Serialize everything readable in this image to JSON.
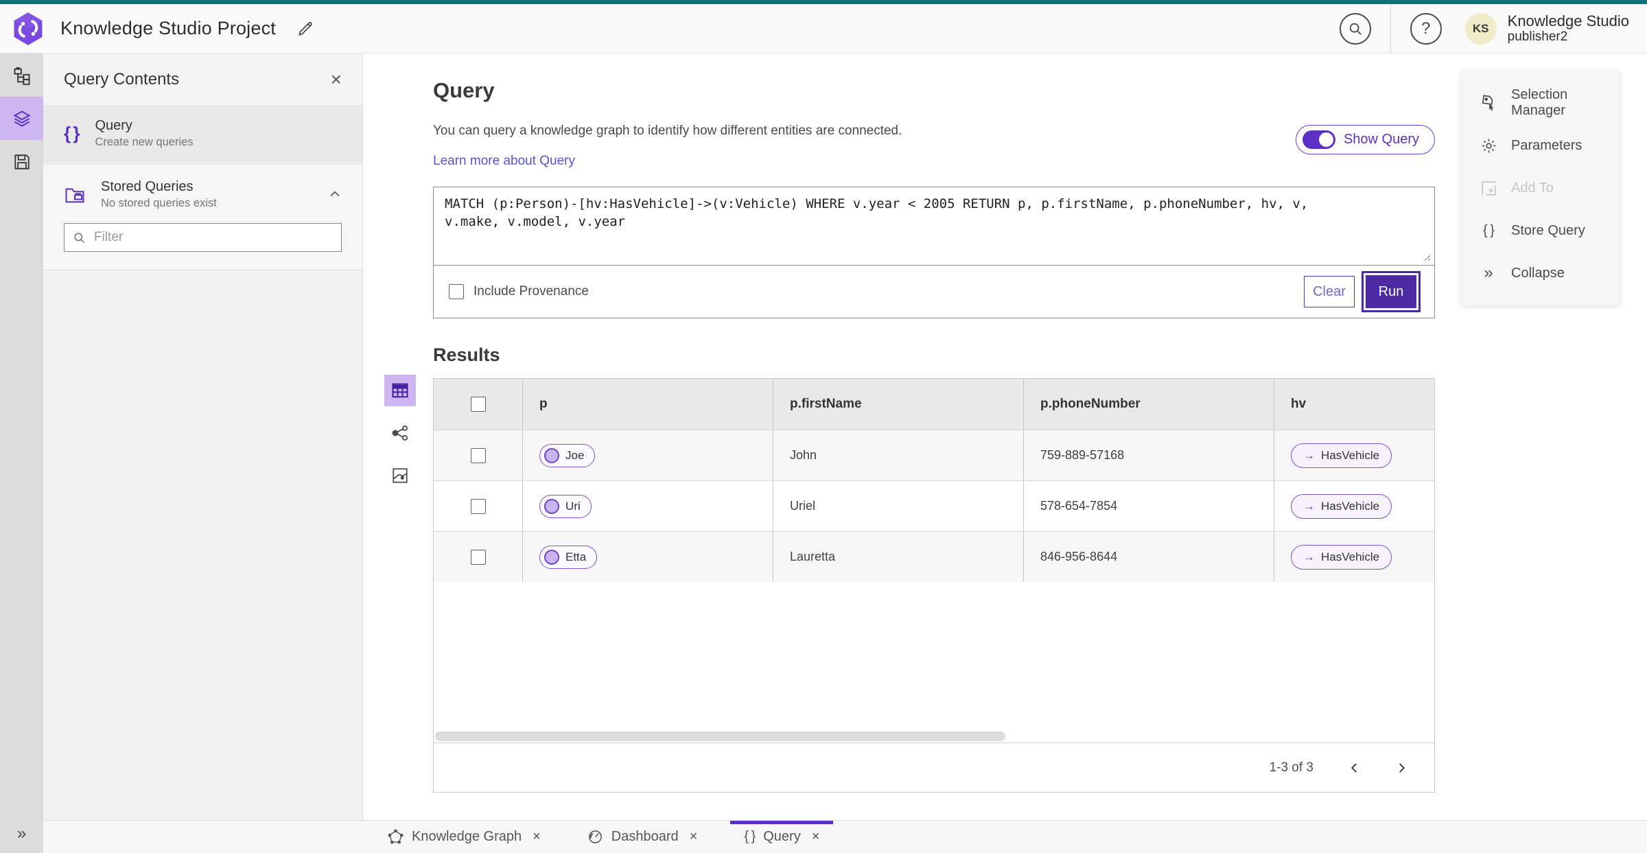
{
  "header": {
    "title": "Knowledge Studio Project",
    "app_name": "Knowledge Studio",
    "user_role": "publisher2",
    "avatar_initials": "KS"
  },
  "icons": {
    "close": "×",
    "help": "?",
    "braces": "{ }",
    "arrow_right": "→",
    "double_chevron": "»"
  },
  "panel": {
    "title": "Query Contents",
    "query_item": {
      "title": "Query",
      "subtitle": "Create new queries"
    },
    "stored_queries": {
      "title": "Stored Queries",
      "subtitle": "No stored queries exist"
    },
    "filter_placeholder": "Filter"
  },
  "main": {
    "title": "Query",
    "description": "You can query a knowledge graph to identify how different entities are connected.",
    "learn_more": "Learn more about Query",
    "show_query_label": "Show Query",
    "query_text": "MATCH (p:Person)-[hv:HasVehicle]->(v:Vehicle) WHERE v.year < 2005 RETURN p, p.firstName, p.phoneNumber, hv, v, v.make, v.model, v.year",
    "include_provenance_label": "Include Provenance",
    "clear_label": "Clear",
    "run_label": "Run",
    "results_title": "Results"
  },
  "table": {
    "columns": [
      "p",
      "p.firstName",
      "p.phoneNumber",
      "hv"
    ],
    "rows": [
      {
        "p": "Joe",
        "firstName": "John",
        "phoneNumber": "759-889-57168",
        "hv": "HasVehicle"
      },
      {
        "p": "Uri",
        "firstName": "Uriel",
        "phoneNumber": "578-654-7854",
        "hv": "HasVehicle"
      },
      {
        "p": "Etta",
        "firstName": "Lauretta",
        "phoneNumber": "846-956-8644",
        "hv": "HasVehicle"
      }
    ],
    "pagination": "1-3 of 3"
  },
  "tools_panel": {
    "items": [
      {
        "label": "Selection Manager"
      },
      {
        "label": "Parameters"
      },
      {
        "label": "Add To"
      },
      {
        "label": "Store Query"
      },
      {
        "label": "Collapse"
      }
    ]
  },
  "tabs": [
    {
      "label": "Knowledge Graph"
    },
    {
      "label": "Dashboard"
    },
    {
      "label": "Query"
    }
  ],
  "colors": {
    "accent": "#5d2fc4",
    "accent_dark": "#4b2aa3",
    "accent_light": "#cdb6f2",
    "top_strip": "#136f7c",
    "link": "#5a51d2"
  }
}
